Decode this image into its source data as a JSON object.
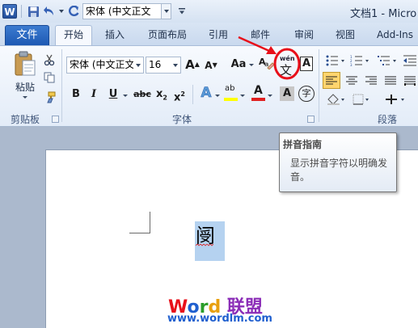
{
  "window": {
    "title": "文档1 - Micro",
    "app_icon_letter": "W",
    "qat_font": "宋体 (中文正文"
  },
  "tabs": {
    "file": "文件",
    "items": [
      "开始",
      "插入",
      "页面布局",
      "引用",
      "邮件",
      "审阅",
      "视图",
      "Add-Ins"
    ],
    "active": "开始"
  },
  "ribbon": {
    "clipboard": {
      "paste_label": "粘贴",
      "group_label": "剪贴板"
    },
    "font": {
      "font_name": "宋体 (中文正文",
      "font_size": "16",
      "grow_label": "A",
      "shrink_label": "A",
      "change_case_label": "Aa",
      "bold_label": "B",
      "italic_label": "I",
      "underline_label": "U",
      "strike_label": "abc",
      "subscript_label": "x",
      "subscript_mark": "2",
      "superscript_label": "x",
      "superscript_mark": "2",
      "highlight_label": "ab",
      "font_color_label": "A",
      "char_shading_label": "A",
      "enclose_char_label": "字",
      "phonetic_label": "文",
      "phonetic_top": "wén",
      "border_label": "A",
      "clear_label": "A",
      "group_label": "字体"
    },
    "paragraph": {
      "group_label": "段落"
    }
  },
  "tooltip": {
    "title": "拼音指南",
    "body": "显示拼音字符以明确发音。"
  },
  "document": {
    "selected_char": "阌"
  },
  "watermark": {
    "brand_word": "Word",
    "brand_cn": "联盟",
    "url": "www.wordlm.com"
  },
  "colors": {
    "file_tab": "#2a67c2",
    "highlight_yellow": "#ffff00",
    "font_red": "#e02020",
    "annotation_red": "#e8101a",
    "selection": "#b5d2f0"
  }
}
